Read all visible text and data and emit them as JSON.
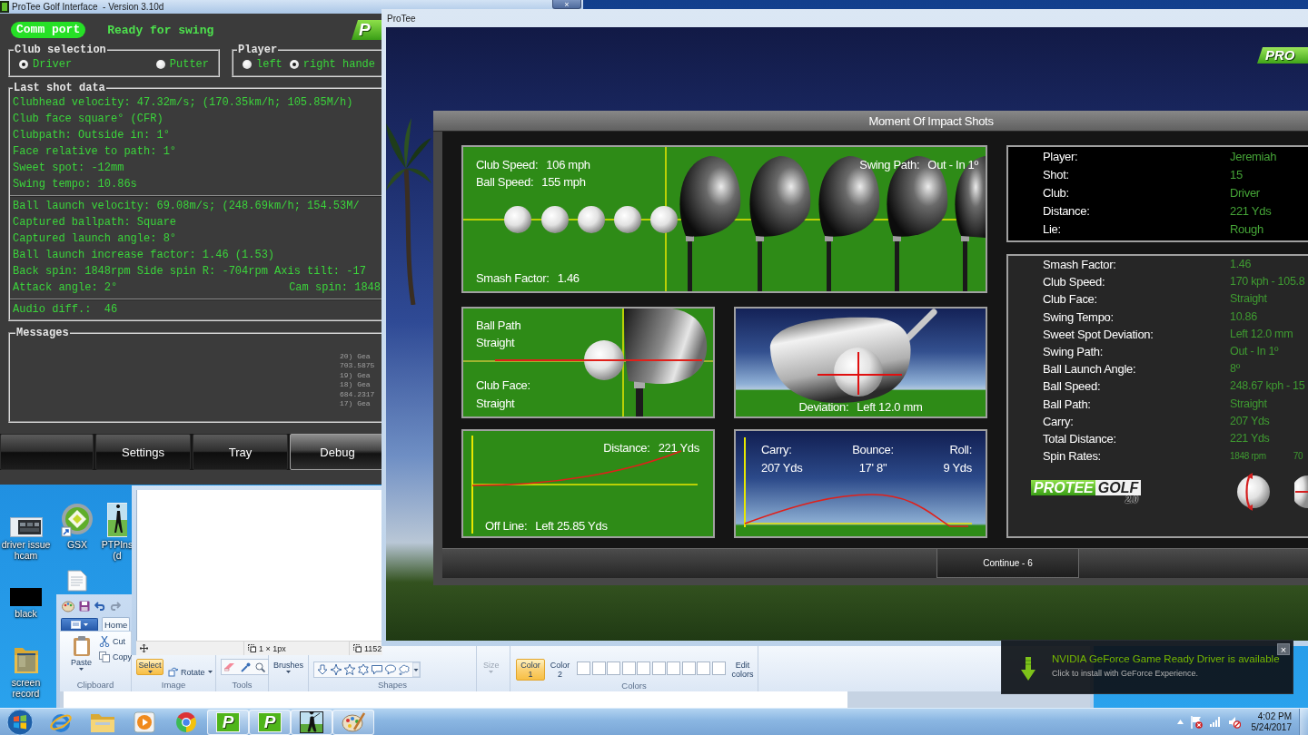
{
  "desktop_icons": [
    [
      {
        "kind": "video",
        "label": "driver issue hcam"
      },
      {
        "kind": "shortcut",
        "label": "GSX"
      },
      {
        "kind": "golfer",
        "label": "PTPIns (d"
      }
    ],
    [
      {
        "kind": "thumbnail",
        "label": "black"
      },
      {
        "kind": "document"
      }
    ],
    [
      {
        "kind": "folder",
        "label": "screen record"
      }
    ]
  ],
  "golf_window": {
    "title": "ProTee Golf Interface  - Version 3.10d",
    "close": "×",
    "comm_button": "Comm port",
    "status": "Ready for swing",
    "logo": "P",
    "club_selection": {
      "legend": "Club selection",
      "options": [
        {
          "label": "Driver",
          "selected": true
        },
        {
          "label": "Putter",
          "selected": false
        }
      ]
    },
    "player": {
      "legend": "Player",
      "options": [
        {
          "label": "left",
          "selected": false
        },
        {
          "label": "right hande",
          "selected": true
        }
      ]
    },
    "last_shot_data": {
      "legend": "Last shot data",
      "groups": [
        [
          [
            "Clubhead velocity: 47.32m/s; (170.35km/h; 105.85M/h)"
          ],
          [
            "Club face square° (CFR)"
          ],
          [
            "Clubpath: Outside in: 1°"
          ],
          [
            "Face relative to path: 1°"
          ],
          [
            "Sweet spot: -12mm"
          ],
          [
            "Swing tempo: 10.86s"
          ]
        ],
        [
          [
            "Ball launch velocity: 69.08m/s; (248.69km/h; 154.53M/"
          ],
          [
            "Captured ballpath: Square"
          ],
          [
            "Captured launch angle: 8°"
          ],
          [
            "Ball launch increase factor: 1.46 (1.53)"
          ],
          [
            "Back spin: 1848rpm Side spin R: -704rpm Axis tilt: -17"
          ],
          [
            "Attack angle: 2°",
            "Cam spin: 1848"
          ]
        ],
        [
          [
            "Audio diff.:  46"
          ]
        ]
      ]
    },
    "messages": {
      "legend": "Messages",
      "lines": [
        "20) Gea",
        "703.5875",
        "19) Gea",
        "18) Gea",
        "684.2317",
        "17) Gea"
      ]
    },
    "buttons": [
      {
        "label": "Settings",
        "selected": false
      },
      {
        "label": "Tray",
        "selected": false
      },
      {
        "label": "Debug",
        "selected": true
      }
    ]
  },
  "protee_window": {
    "title": "ProTee",
    "logo": "PRO",
    "dialog": {
      "title": "Moment Of Impact Shots",
      "impact": {
        "speeds": [
          {
            "label": "Club Speed:",
            "value": "106 mph"
          },
          {
            "label": "Ball Speed:",
            "value": "155 mph"
          }
        ],
        "swing_path": {
          "label": "Swing Path:",
          "value": "Out - In 1º"
        },
        "smash_factor": {
          "label": "Smash Factor:",
          "value": "1.46"
        }
      },
      "ball_path": {
        "label": "Ball Path",
        "value": "Straight"
      },
      "club_face": {
        "label": "Club Face:",
        "value": "Straight"
      },
      "deviation": {
        "label": "Deviation:",
        "value": "Left 12.0 mm"
      },
      "distance": {
        "label": "Distance:",
        "value": "221 Yds"
      },
      "off_line": {
        "label": "Off Line:",
        "value": "Left 25.85 Yds"
      },
      "flight": [
        {
          "label": "Carry:",
          "value": "207 Yds"
        },
        {
          "label": "Bounce:",
          "value": "17' 8\""
        },
        {
          "label": "Roll:",
          "value": "9 Yds"
        }
      ],
      "shot_info": [
        {
          "label": "Player:",
          "value": "Jeremiah"
        },
        {
          "label": "Shot:",
          "value": "15"
        },
        {
          "label": "Club:",
          "value": "Driver"
        },
        {
          "label": "Distance:",
          "value": "221 Yds"
        },
        {
          "label": "Lie:",
          "value": "Rough"
        }
      ],
      "stats": [
        {
          "label": "Smash Factor:",
          "values": [
            "1.46"
          ]
        },
        {
          "label": "Club Speed:",
          "values": [
            "170 kph - 105.8"
          ]
        },
        {
          "label": "Club Face:",
          "values": [
            "Straight"
          ]
        },
        {
          "label": "Swing Tempo:",
          "values": [
            "10.86"
          ]
        },
        {
          "label": "Sweet Spot Deviation:",
          "values": [
            "Left 12.0 mm"
          ]
        },
        {
          "label": "Swing Path:",
          "values": [
            "Out - In 1º"
          ]
        },
        {
          "label": "Ball Launch Angle:",
          "values": [
            "8º"
          ]
        },
        {
          "label": "Ball Speed:",
          "values": [
            "248.67 kph - 15"
          ]
        },
        {
          "label": "Ball Path:",
          "values": [
            "Straight"
          ]
        },
        {
          "label": "Carry:",
          "values": [
            "207 Yds"
          ]
        },
        {
          "label": "Total Distance:",
          "values": [
            "221 Yds"
          ]
        },
        {
          "label": "Spin Rates:",
          "values": [
            "1848 rpm",
            "70"
          ]
        }
      ],
      "brand_logo": {
        "name": "PROTEE",
        "accent": "GOLF",
        "version": "2.0"
      },
      "continue_button": "Continue - 6"
    }
  },
  "paint_canvas_window": {
    "status": [
      "1 × 1px",
      "1152"
    ]
  },
  "paint_window": {
    "tabs": [
      {
        "label": "Home",
        "selected": true
      }
    ],
    "groups": [
      {
        "kind": "clipboard",
        "label": "Clipboard",
        "items": [
          {
            "label": "Paste"
          },
          {
            "label": "Cut"
          },
          {
            "label": "Copy"
          }
        ]
      },
      {
        "kind": "image",
        "label": "Image",
        "items": [
          {
            "label": "Select",
            "selected": true
          },
          {
            "label": "Rotate",
            "selected": false
          }
        ]
      },
      {
        "kind": "tools",
        "label": "Tools"
      },
      {
        "kind": "brushes",
        "items": [
          {
            "label": "Brushes"
          }
        ]
      },
      {
        "kind": "shapes",
        "label": "Shapes"
      },
      {
        "kind": "size",
        "items": [
          {
            "label": "Size",
            "disabled": true
          }
        ]
      },
      {
        "kind": "colors",
        "label": "Colors",
        "items": [
          {
            "label": "Color 1",
            "selected": true
          },
          {
            "label": "Color 2",
            "selected": false
          },
          {
            "label": "Edit colors"
          }
        ]
      }
    ]
  },
  "notification": {
    "title": "NVIDIA GeForce Game Ready Driver is available",
    "body": "Click to install with GeForce Experience.",
    "close": "×"
  },
  "taskbar": {
    "apps": [
      {
        "kind": "browser",
        "running": false
      },
      {
        "kind": "folder",
        "running": false
      },
      {
        "kind": "media",
        "running": false
      },
      {
        "kind": "chrome",
        "running": false
      },
      {
        "kind": "letter",
        "letter": "P",
        "running": true
      },
      {
        "kind": "letter",
        "letter": "P",
        "running": true
      },
      {
        "kind": "golf",
        "running": true
      },
      {
        "kind": "paint",
        "running": true
      }
    ],
    "tray": {
      "action_center_alert": true,
      "volume_muted": true
    },
    "clock": {
      "time": "4:02 PM",
      "date": "5/24/2017"
    }
  }
}
